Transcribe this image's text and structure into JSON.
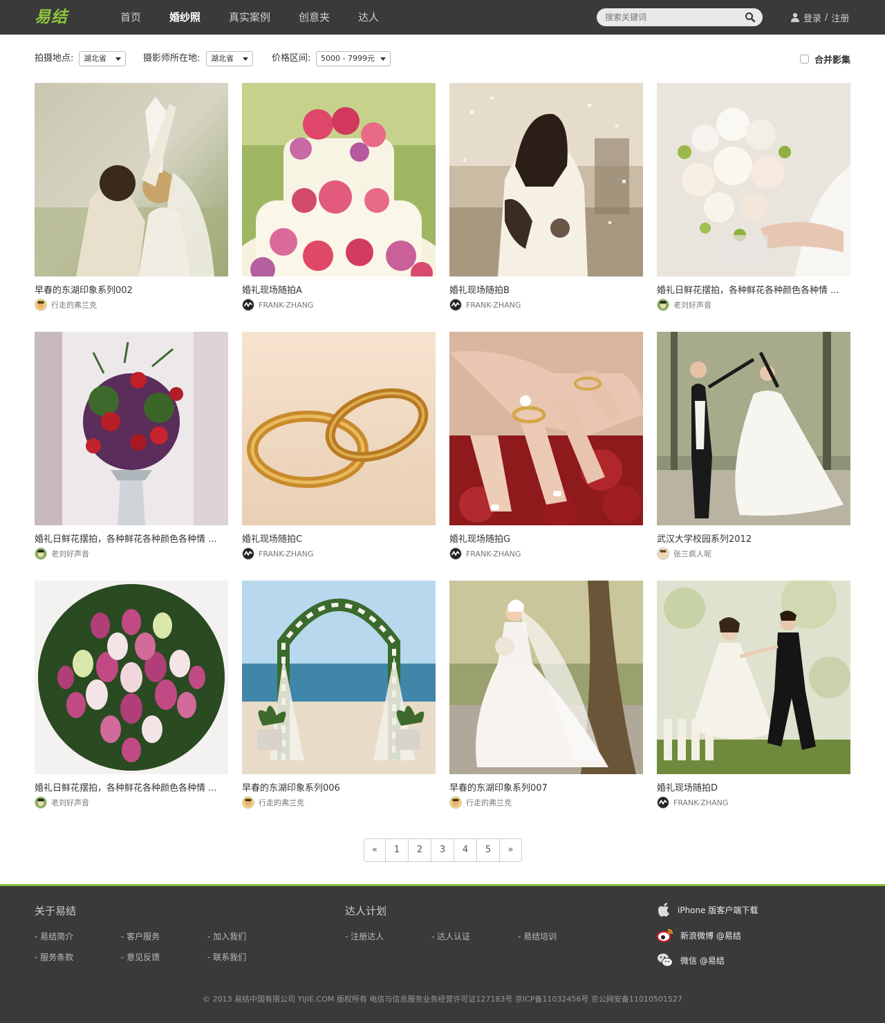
{
  "header": {
    "logo": "易结",
    "nav": [
      {
        "label": "首页"
      },
      {
        "label": "婚纱照"
      },
      {
        "label": "真实案例"
      },
      {
        "label": "创意夹"
      },
      {
        "label": "达人"
      }
    ],
    "search_placeholder": "搜索关键词",
    "login": "登录",
    "separator": "/",
    "register": "注册"
  },
  "filters": {
    "location_label": "拍摄地点:",
    "location_value": "湖北省",
    "photographer_label": "摄影师所在地:",
    "photographer_value": "湖北省",
    "price_label": "价格区间:",
    "price_value": "5000 - 7999元",
    "merge_label": "合并影集",
    "merge_checked": false
  },
  "albums": [
    {
      "title": "早春的东湖印象系列002",
      "author": "行走的弗兰克",
      "photo": "couple-kiss"
    },
    {
      "title": "婚礼现场随拍A",
      "author": "FRANK-ZHANG",
      "photo": "wedding-cake"
    },
    {
      "title": "婚礼现场随拍B",
      "author": "FRANK-ZHANG",
      "photo": "sepia-dance"
    },
    {
      "title": "婚礼日鲜花摆拍，各种鲜花各种颜色各种情 ...",
      "author": "老刘好声音",
      "photo": "white-bouquet"
    },
    {
      "title": "婚礼日鲜花摆拍，各种鲜花各种颜色各种情 ...",
      "author": "老刘好声音",
      "photo": "flower-vase"
    },
    {
      "title": "婚礼现场随拍C",
      "author": "FRANK-ZHANG",
      "photo": "gold-rings"
    },
    {
      "title": "婚礼现场随拍G",
      "author": "FRANK-ZHANG",
      "photo": "ring-hands"
    },
    {
      "title": "武汉大学校园系列2012",
      "author": "张三疯人呢",
      "photo": "dancing-couple"
    },
    {
      "title": "婚礼日鲜花摆拍，各种鲜花各种颜色各种情 ...",
      "author": "老刘好声音",
      "photo": "tulip-bouquet"
    },
    {
      "title": "早春的东湖印象系列006",
      "author": "行走的弗兰克",
      "photo": "beach-arch"
    },
    {
      "title": "早春的东湖印象系列007",
      "author": "行走的弗兰克",
      "photo": "bride-veil"
    },
    {
      "title": "婚礼现场随拍D",
      "author": "FRANK-ZHANG",
      "photo": "cake-topper"
    }
  ],
  "pagination": [
    "«",
    "1",
    "2",
    "3",
    "4",
    "5",
    "»"
  ],
  "footer": {
    "about_heading": "关于易结",
    "about_links": [
      "- 易结简介",
      "- 客户服务",
      "- 加入我们",
      "- 服务条款",
      "- 意见反馈",
      "- 联系我们"
    ],
    "expert_heading": "达人计划",
    "expert_links": [
      "- 注册达人",
      "- 达人认证",
      "- 易结培训"
    ],
    "iphone": "iPhone 版客户端下载",
    "weibo": "新浪微博 @易结",
    "wechat": "微信 @易结",
    "copyright": "© 2013  易结中国有限公司 YIJIE.COM  版权所有    电信与信息服务业务经营许可证127183号    京ICP备11032456号    京公网安备11010501527"
  },
  "colors": {
    "topbar": "#3a3a3a",
    "accent": "#7cc03b",
    "footer": "#3a3a3a"
  }
}
